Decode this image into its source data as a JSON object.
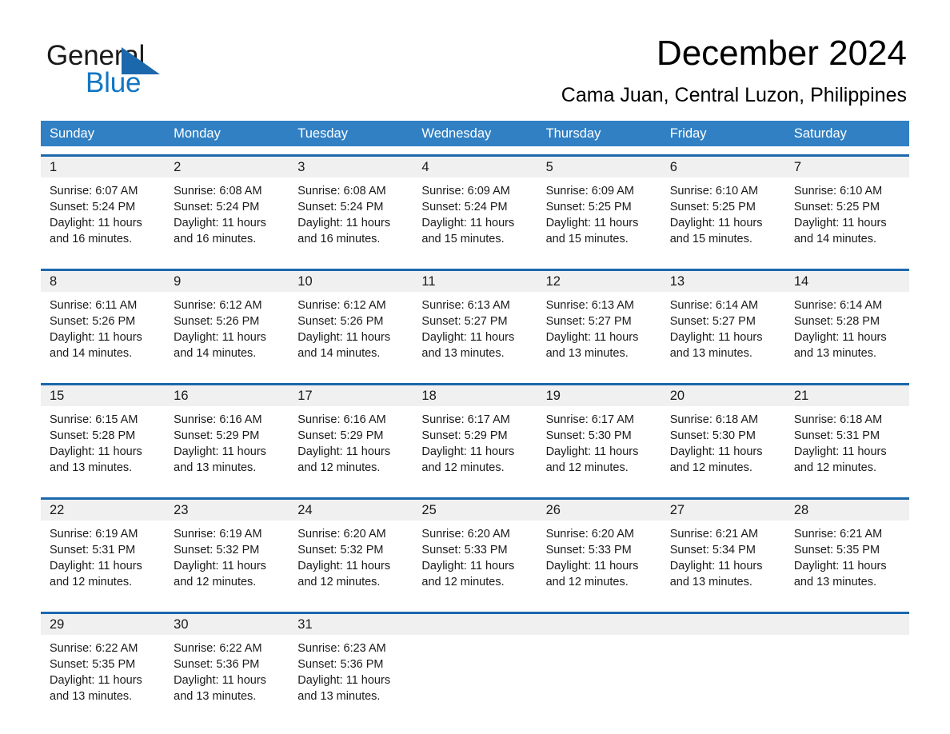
{
  "brand": {
    "name_part1": "General",
    "name_part2": "Blue",
    "triangle_color": "#1c68ad",
    "blue_text_color": "#1277c4"
  },
  "header": {
    "title": "December 2024",
    "subtitle": "Cama Juan, Central Luzon, Philippines"
  },
  "theme": {
    "header_row_bg": "#3180c4",
    "week_rule": "#1c68ad",
    "date_band_bg": "#f0f0f0",
    "page_bg": "#ffffff",
    "text": "#1a1a1a"
  },
  "weekdays": [
    "Sunday",
    "Monday",
    "Tuesday",
    "Wednesday",
    "Thursday",
    "Friday",
    "Saturday"
  ],
  "weeks": [
    {
      "days": [
        {
          "date": "1",
          "sunrise": "Sunrise: 6:07 AM",
          "sunset": "Sunset: 5:24 PM",
          "daylight": "Daylight: 11 hours and 16 minutes."
        },
        {
          "date": "2",
          "sunrise": "Sunrise: 6:08 AM",
          "sunset": "Sunset: 5:24 PM",
          "daylight": "Daylight: 11 hours and 16 minutes."
        },
        {
          "date": "3",
          "sunrise": "Sunrise: 6:08 AM",
          "sunset": "Sunset: 5:24 PM",
          "daylight": "Daylight: 11 hours and 16 minutes."
        },
        {
          "date": "4",
          "sunrise": "Sunrise: 6:09 AM",
          "sunset": "Sunset: 5:24 PM",
          "daylight": "Daylight: 11 hours and 15 minutes."
        },
        {
          "date": "5",
          "sunrise": "Sunrise: 6:09 AM",
          "sunset": "Sunset: 5:25 PM",
          "daylight": "Daylight: 11 hours and 15 minutes."
        },
        {
          "date": "6",
          "sunrise": "Sunrise: 6:10 AM",
          "sunset": "Sunset: 5:25 PM",
          "daylight": "Daylight: 11 hours and 15 minutes."
        },
        {
          "date": "7",
          "sunrise": "Sunrise: 6:10 AM",
          "sunset": "Sunset: 5:25 PM",
          "daylight": "Daylight: 11 hours and 14 minutes."
        }
      ]
    },
    {
      "days": [
        {
          "date": "8",
          "sunrise": "Sunrise: 6:11 AM",
          "sunset": "Sunset: 5:26 PM",
          "daylight": "Daylight: 11 hours and 14 minutes."
        },
        {
          "date": "9",
          "sunrise": "Sunrise: 6:12 AM",
          "sunset": "Sunset: 5:26 PM",
          "daylight": "Daylight: 11 hours and 14 minutes."
        },
        {
          "date": "10",
          "sunrise": "Sunrise: 6:12 AM",
          "sunset": "Sunset: 5:26 PM",
          "daylight": "Daylight: 11 hours and 14 minutes."
        },
        {
          "date": "11",
          "sunrise": "Sunrise: 6:13 AM",
          "sunset": "Sunset: 5:27 PM",
          "daylight": "Daylight: 11 hours and 13 minutes."
        },
        {
          "date": "12",
          "sunrise": "Sunrise: 6:13 AM",
          "sunset": "Sunset: 5:27 PM",
          "daylight": "Daylight: 11 hours and 13 minutes."
        },
        {
          "date": "13",
          "sunrise": "Sunrise: 6:14 AM",
          "sunset": "Sunset: 5:27 PM",
          "daylight": "Daylight: 11 hours and 13 minutes."
        },
        {
          "date": "14",
          "sunrise": "Sunrise: 6:14 AM",
          "sunset": "Sunset: 5:28 PM",
          "daylight": "Daylight: 11 hours and 13 minutes."
        }
      ]
    },
    {
      "days": [
        {
          "date": "15",
          "sunrise": "Sunrise: 6:15 AM",
          "sunset": "Sunset: 5:28 PM",
          "daylight": "Daylight: 11 hours and 13 minutes."
        },
        {
          "date": "16",
          "sunrise": "Sunrise: 6:16 AM",
          "sunset": "Sunset: 5:29 PM",
          "daylight": "Daylight: 11 hours and 13 minutes."
        },
        {
          "date": "17",
          "sunrise": "Sunrise: 6:16 AM",
          "sunset": "Sunset: 5:29 PM",
          "daylight": "Daylight: 11 hours and 12 minutes."
        },
        {
          "date": "18",
          "sunrise": "Sunrise: 6:17 AM",
          "sunset": "Sunset: 5:29 PM",
          "daylight": "Daylight: 11 hours and 12 minutes."
        },
        {
          "date": "19",
          "sunrise": "Sunrise: 6:17 AM",
          "sunset": "Sunset: 5:30 PM",
          "daylight": "Daylight: 11 hours and 12 minutes."
        },
        {
          "date": "20",
          "sunrise": "Sunrise: 6:18 AM",
          "sunset": "Sunset: 5:30 PM",
          "daylight": "Daylight: 11 hours and 12 minutes."
        },
        {
          "date": "21",
          "sunrise": "Sunrise: 6:18 AM",
          "sunset": "Sunset: 5:31 PM",
          "daylight": "Daylight: 11 hours and 12 minutes."
        }
      ]
    },
    {
      "days": [
        {
          "date": "22",
          "sunrise": "Sunrise: 6:19 AM",
          "sunset": "Sunset: 5:31 PM",
          "daylight": "Daylight: 11 hours and 12 minutes."
        },
        {
          "date": "23",
          "sunrise": "Sunrise: 6:19 AM",
          "sunset": "Sunset: 5:32 PM",
          "daylight": "Daylight: 11 hours and 12 minutes."
        },
        {
          "date": "24",
          "sunrise": "Sunrise: 6:20 AM",
          "sunset": "Sunset: 5:32 PM",
          "daylight": "Daylight: 11 hours and 12 minutes."
        },
        {
          "date": "25",
          "sunrise": "Sunrise: 6:20 AM",
          "sunset": "Sunset: 5:33 PM",
          "daylight": "Daylight: 11 hours and 12 minutes."
        },
        {
          "date": "26",
          "sunrise": "Sunrise: 6:20 AM",
          "sunset": "Sunset: 5:33 PM",
          "daylight": "Daylight: 11 hours and 12 minutes."
        },
        {
          "date": "27",
          "sunrise": "Sunrise: 6:21 AM",
          "sunset": "Sunset: 5:34 PM",
          "daylight": "Daylight: 11 hours and 13 minutes."
        },
        {
          "date": "28",
          "sunrise": "Sunrise: 6:21 AM",
          "sunset": "Sunset: 5:35 PM",
          "daylight": "Daylight: 11 hours and 13 minutes."
        }
      ]
    },
    {
      "days": [
        {
          "date": "29",
          "sunrise": "Sunrise: 6:22 AM",
          "sunset": "Sunset: 5:35 PM",
          "daylight": "Daylight: 11 hours and 13 minutes."
        },
        {
          "date": "30",
          "sunrise": "Sunrise: 6:22 AM",
          "sunset": "Sunset: 5:36 PM",
          "daylight": "Daylight: 11 hours and 13 minutes."
        },
        {
          "date": "31",
          "sunrise": "Sunrise: 6:23 AM",
          "sunset": "Sunset: 5:36 PM",
          "daylight": "Daylight: 11 hours and 13 minutes."
        },
        {
          "date": "",
          "sunrise": "",
          "sunset": "",
          "daylight": ""
        },
        {
          "date": "",
          "sunrise": "",
          "sunset": "",
          "daylight": ""
        },
        {
          "date": "",
          "sunrise": "",
          "sunset": "",
          "daylight": ""
        },
        {
          "date": "",
          "sunrise": "",
          "sunset": "",
          "daylight": ""
        }
      ]
    }
  ]
}
